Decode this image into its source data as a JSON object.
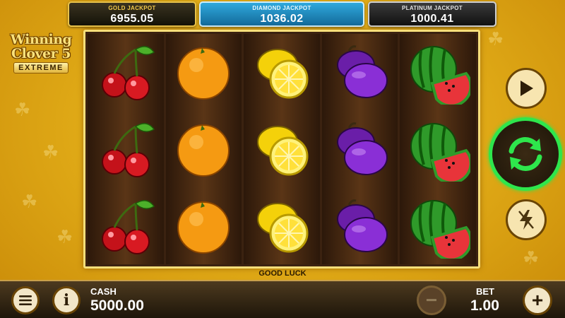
{
  "jackpots": {
    "gold": {
      "label": "GOLD JACKPOT",
      "value": "6955.05"
    },
    "diamond": {
      "label": "DIAMOND JACKPOT",
      "value": "1036.02"
    },
    "platinum": {
      "label": "PLATINUM JACKPOT",
      "value": "1000.41"
    }
  },
  "logo": {
    "line1": "Winning",
    "line2": "Clover 5",
    "sub": "EXTREME"
  },
  "reels": [
    [
      "cherry",
      "cherry",
      "cherry"
    ],
    [
      "orange",
      "orange",
      "orange"
    ],
    [
      "lemon",
      "lemon",
      "lemon"
    ],
    [
      "plum",
      "plum",
      "plum"
    ],
    [
      "watermelon",
      "watermelon",
      "watermelon"
    ]
  ],
  "status": {
    "message": "GOOD LUCK"
  },
  "controls": {
    "play_icon": "play-icon",
    "spin_icon": "autospin-arrows-icon",
    "turbo_icon": "lightning-icon"
  },
  "bottom": {
    "menu_icon": "hamburger-menu-icon",
    "info_glyph": "i",
    "cash_label": "CASH",
    "cash_value": "5000.00",
    "bet_label": "BET",
    "bet_value": "1.00",
    "minus_glyph": "−",
    "plus_glyph": "+"
  },
  "colors": {
    "accent_green": "#2ee64c",
    "gold": "#e2ad18"
  }
}
